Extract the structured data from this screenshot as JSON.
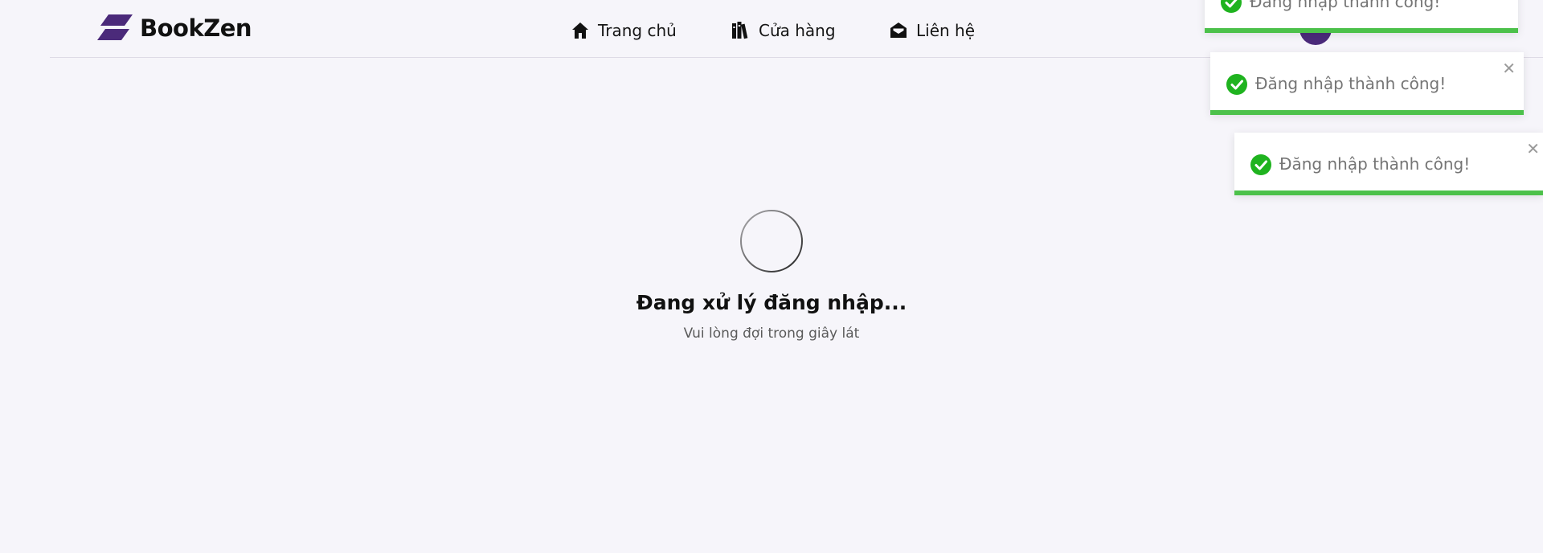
{
  "brand": {
    "name": "BookZen",
    "accent_color": "#4b2a7a",
    "logo_icon": "bookzen-logo-icon"
  },
  "nav": {
    "items": [
      {
        "label": "Trang chủ",
        "icon": "home-icon"
      },
      {
        "label": "Cửa hàng",
        "icon": "books-icon"
      },
      {
        "label": "Liên hệ",
        "icon": "envelope-open-icon"
      }
    ]
  },
  "user": {
    "icon": "user-circle-icon"
  },
  "toasts": [
    {
      "message": "Đăng nhập thành công!",
      "icon": "check-circle-icon",
      "status_color": "#4cc14a",
      "close_icon": "close-icon"
    },
    {
      "message": "Đăng nhập thành công!",
      "icon": "check-circle-icon",
      "status_color": "#4cc14a",
      "close_icon": "close-icon"
    },
    {
      "message": "Đăng nhập thành công!",
      "icon": "check-circle-icon",
      "status_color": "#4cc14a",
      "close_icon": "close-icon"
    }
  ],
  "main": {
    "title": "Đang xử lý đăng nhập...",
    "subtitle": "Vui lòng đợi trong giây lát"
  }
}
